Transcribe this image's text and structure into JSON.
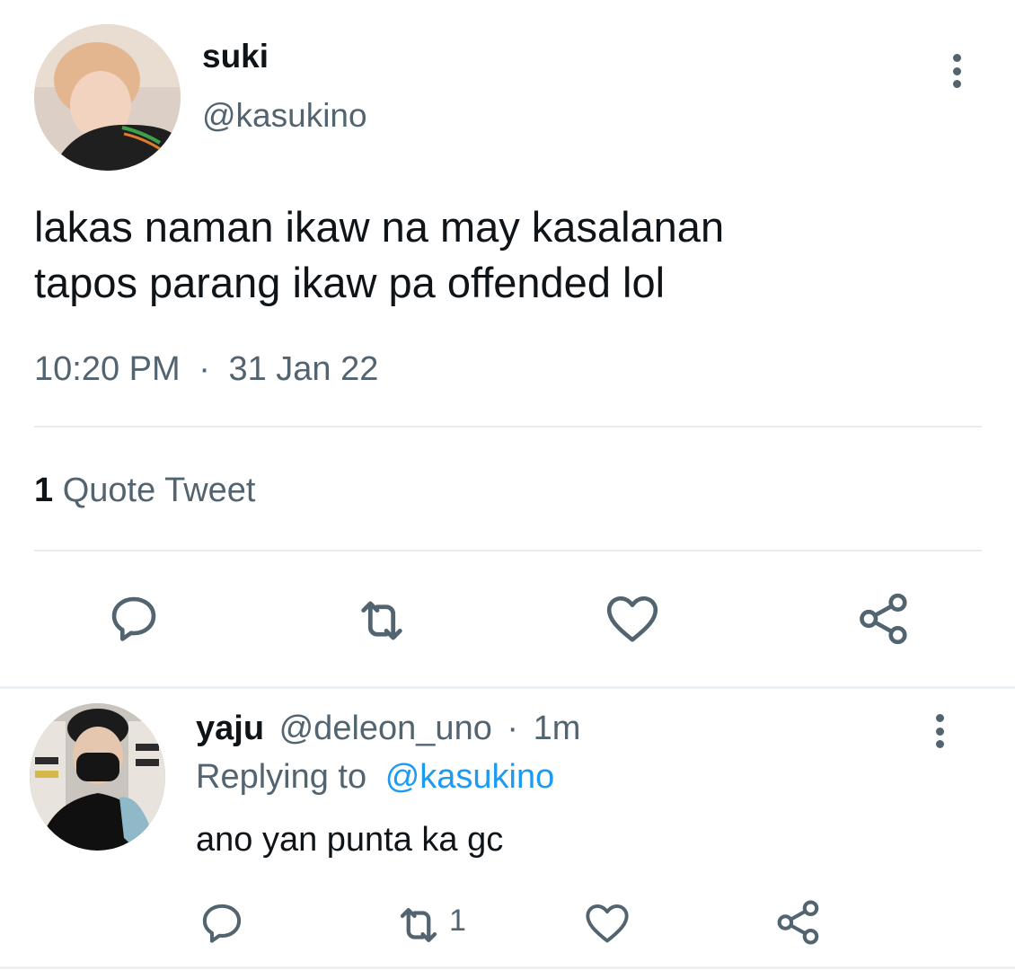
{
  "main_tweet": {
    "author_name": "suki",
    "author_handle": "@kasukino",
    "text_line1": "lakas naman ikaw na may kasalanan",
    "text_line2": "tapos parang ikaw pa offended lol",
    "time": "10:20 PM",
    "separator": "·",
    "date": "31 Jan 22",
    "quote_count": "1",
    "quote_label": "Quote Tweet",
    "actions": [
      "reply-icon",
      "retweet-icon",
      "like-icon",
      "share-icon"
    ]
  },
  "reply_tweet": {
    "author_name": "yaju",
    "author_handle": "@deleon_uno",
    "separator": "·",
    "time": "1m",
    "replying_prefix": "Replying to",
    "replying_handle": "@kasukino",
    "text": "ano yan punta ka gc",
    "retweet_count": "1",
    "actions": [
      "reply-icon",
      "retweet-icon",
      "like-icon",
      "share-icon"
    ]
  },
  "colors": {
    "primary_text": "#0f1419",
    "secondary_text": "#536471",
    "link": "#1d9bf0",
    "divider": "#e6ecf0"
  }
}
